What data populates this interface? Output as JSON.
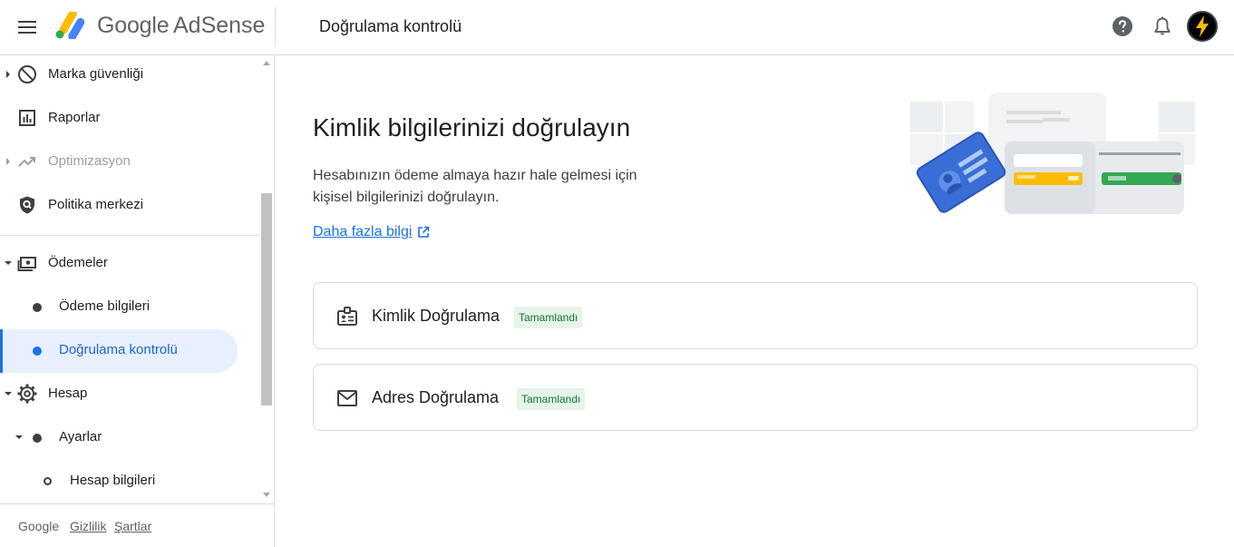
{
  "header": {
    "logo_google": "Google",
    "logo_product": "AdSense",
    "page_title": "Doğrulama kontrolü"
  },
  "sidebar": {
    "items": [
      {
        "label": "Marka güvenliği",
        "icon": "block-icon",
        "expandable": true
      },
      {
        "label": "Raporlar",
        "icon": "bar-chart-icon"
      },
      {
        "label": "Optimizasyon",
        "icon": "trending-up-icon",
        "expandable": true,
        "disabled": true
      },
      {
        "label": "Politika merkezi",
        "icon": "shield-search-icon"
      },
      {
        "label": "Ödemeler",
        "icon": "payments-icon",
        "expanded": true
      },
      {
        "label": "Ödeme bilgileri",
        "level": 1
      },
      {
        "label": "Doğrulama kontrolü",
        "level": 1,
        "active": true
      },
      {
        "label": "Hesap",
        "icon": "gear-icon",
        "expanded": true
      },
      {
        "label": "Ayarlar",
        "level": 1,
        "expanded": true
      },
      {
        "label": "Hesap bilgileri",
        "level": 2
      }
    ],
    "footer": {
      "google": "Google",
      "privacy": "Gizlilik",
      "terms": "Şartlar"
    }
  },
  "main": {
    "title": "Kimlik bilgilerinizi doğrulayın",
    "description": "Hesabınızın ödeme almaya hazır hale gelmesi için kişisel bilgilerinizi doğrulayın.",
    "learn_more": "Daha fazla bilgi",
    "cards": [
      {
        "label": "Kimlik Doğrulama",
        "status": "Tamamlandı",
        "icon": "id-badge-icon"
      },
      {
        "label": "Adres Doğrulama",
        "status": "Tamamlandı",
        "icon": "mail-icon"
      }
    ]
  },
  "colors": {
    "accent": "#1a73e8",
    "active_bg": "#e8f0fe",
    "status_bg": "#e6f4ea",
    "status_text": "#137333"
  }
}
